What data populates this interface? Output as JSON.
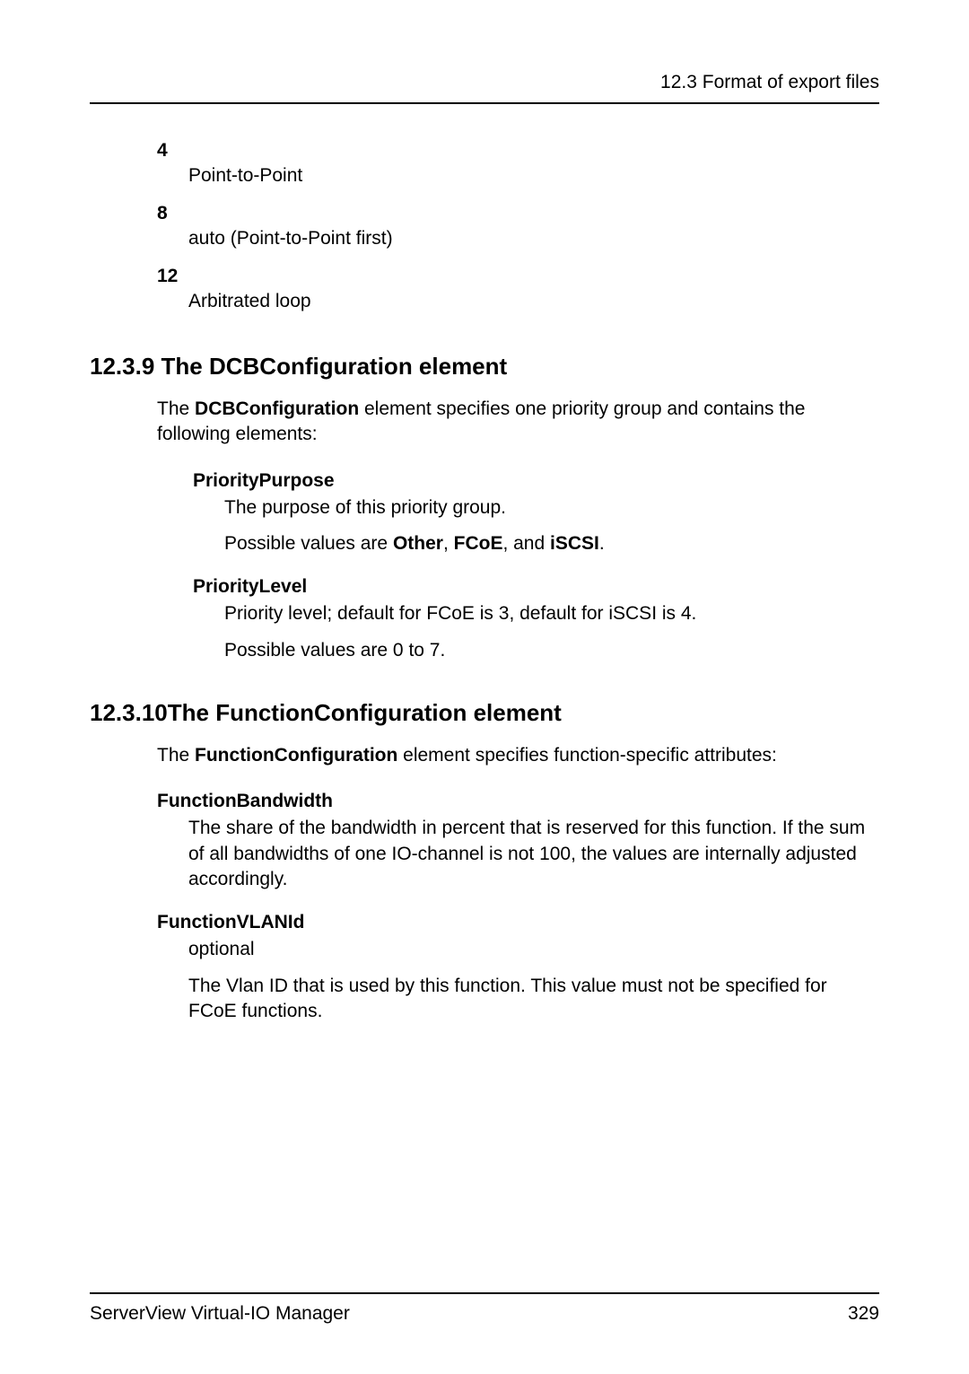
{
  "header": {
    "section_path": "12.3 Format of export files"
  },
  "topologies": [
    {
      "code": "4",
      "label": "Point-to-Point"
    },
    {
      "code": "8",
      "label": "auto (Point-to-Point first)"
    },
    {
      "code": "12",
      "label": "Arbitrated loop"
    }
  ],
  "sec1239": {
    "heading": "12.3.9 The DCBConfiguration element",
    "intro_parts": [
      "The ",
      "DCBConfiguration",
      " element specifies one priority group and contains the following elements:"
    ],
    "items": [
      {
        "term": "PriorityPurpose",
        "paras": [
          {
            "runs": [
              {
                "t": "The purpose of this priority group.",
                "b": false
              }
            ]
          },
          {
            "runs": [
              {
                "t": "Possible values are ",
                "b": false
              },
              {
                "t": "Other",
                "b": true
              },
              {
                "t": ", ",
                "b": false
              },
              {
                "t": "FCoE",
                "b": true
              },
              {
                "t": ", and ",
                "b": false
              },
              {
                "t": "iSCSI",
                "b": true
              },
              {
                "t": ".",
                "b": false
              }
            ]
          }
        ]
      },
      {
        "term": "PriorityLevel",
        "paras": [
          {
            "runs": [
              {
                "t": "Priority level; default for FCoE is 3, default for iSCSI is 4.",
                "b": false
              }
            ]
          },
          {
            "runs": [
              {
                "t": "Possible values are 0 to 7.",
                "b": false
              }
            ]
          }
        ]
      }
    ]
  },
  "sec12310": {
    "heading": "12.3.10The FunctionConfiguration element",
    "intro_parts": [
      "The ",
      "FunctionConfiguration",
      " element specifies function-specific attributes:"
    ],
    "items": [
      {
        "term": "FunctionBandwidth",
        "paras": [
          {
            "runs": [
              {
                "t": "The share of the bandwidth in percent that is reserved for this function. If the sum of all bandwidths of one IO-channel is not 100, the values are internally adjusted accordingly.",
                "b": false
              }
            ]
          }
        ]
      },
      {
        "term": "FunctionVLANId",
        "paras": [
          {
            "runs": [
              {
                "t": "optional",
                "b": false
              }
            ]
          },
          {
            "runs": [
              {
                "t": "The Vlan ID that is used by this function. This value must not be specified for FCoE functions.",
                "b": false
              }
            ]
          }
        ]
      }
    ]
  },
  "footer": {
    "product": "ServerView Virtual-IO Manager",
    "page": "329"
  }
}
